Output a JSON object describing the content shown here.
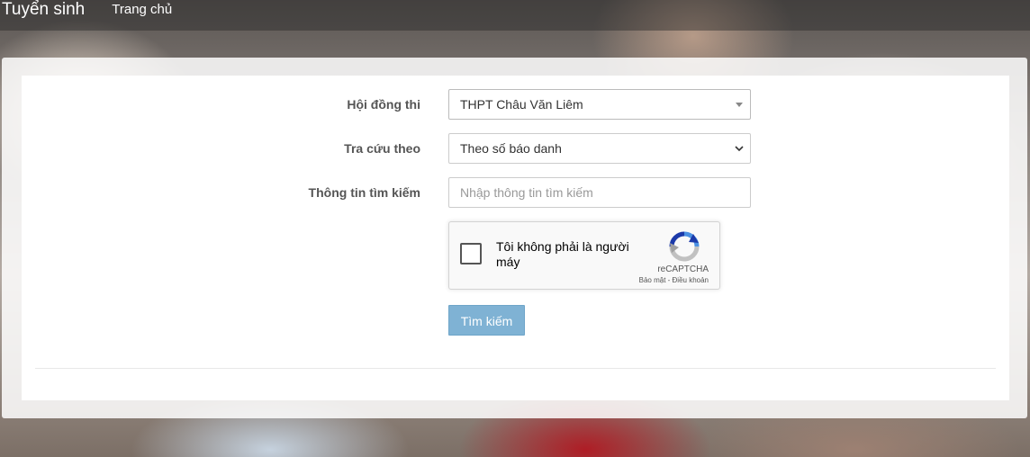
{
  "navbar": {
    "brand": "Tuyển sinh",
    "links": [
      {
        "label": "Trang chủ"
      }
    ]
  },
  "form": {
    "exam_council": {
      "label": "Hội đồng thi",
      "value": "THPT Châu Văn Liêm"
    },
    "lookup_by": {
      "label": "Tra cứu theo",
      "value": "Theo số báo danh"
    },
    "search_info": {
      "label": "Thông tin tìm kiếm",
      "placeholder": "Nhập thông tin tìm kiếm"
    },
    "recaptcha": {
      "label": "Tôi không phải là người máy",
      "brand": "reCAPTCHA",
      "links": "Bảo mật - Điều khoản"
    },
    "submit_label": "Tìm kiếm"
  },
  "colors": {
    "button": "#7fb2d4",
    "label": "#555555",
    "recaptcha_blue": "#1c3aa9",
    "recaptcha_lightblue": "#4a90e2",
    "recaptcha_gray": "#c1c1c1"
  }
}
